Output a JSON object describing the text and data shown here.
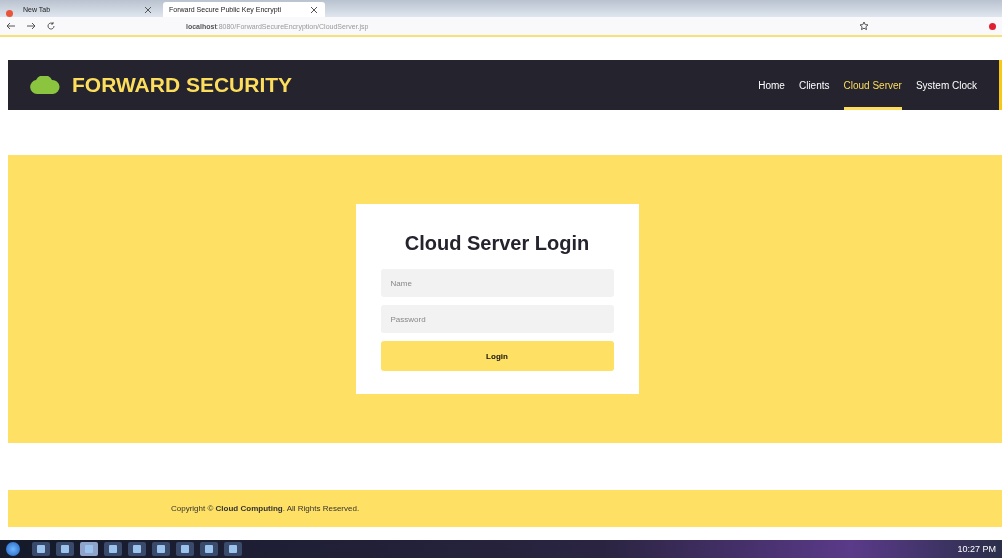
{
  "browser": {
    "tabs": [
      {
        "label": "New Tab",
        "selected": false
      },
      {
        "label": "Forward Secure Public Key Encrypti",
        "selected": true
      }
    ],
    "address": {
      "host": "localhost",
      "path": ":8080/ForwardSecureEncryption/CloudServer.jsp"
    }
  },
  "nav": {
    "brand": "FORWARD SECURITY",
    "items": [
      {
        "label": "Home",
        "selected": false
      },
      {
        "label": "Clients",
        "selected": false
      },
      {
        "label": "Cloud Server",
        "selected": true
      },
      {
        "label": "System Clock",
        "selected": false
      }
    ]
  },
  "login": {
    "title": "Cloud Server Login",
    "fields": [
      {
        "placeholder": "Name"
      },
      {
        "placeholder": "Password"
      }
    ],
    "button": "Login"
  },
  "footer": {
    "text": "Copyright © **Cloud Computing**. All Rights Reserved."
  },
  "taskbar": {
    "apps": [
      {
        "selected": false
      },
      {
        "selected": false
      },
      {
        "selected": true
      },
      {
        "selected": false
      },
      {
        "selected": false
      },
      {
        "selected": false
      },
      {
        "selected": false
      },
      {
        "selected": false
      },
      {
        "selected": false
      }
    ],
    "clock": "10:27 PM"
  }
}
